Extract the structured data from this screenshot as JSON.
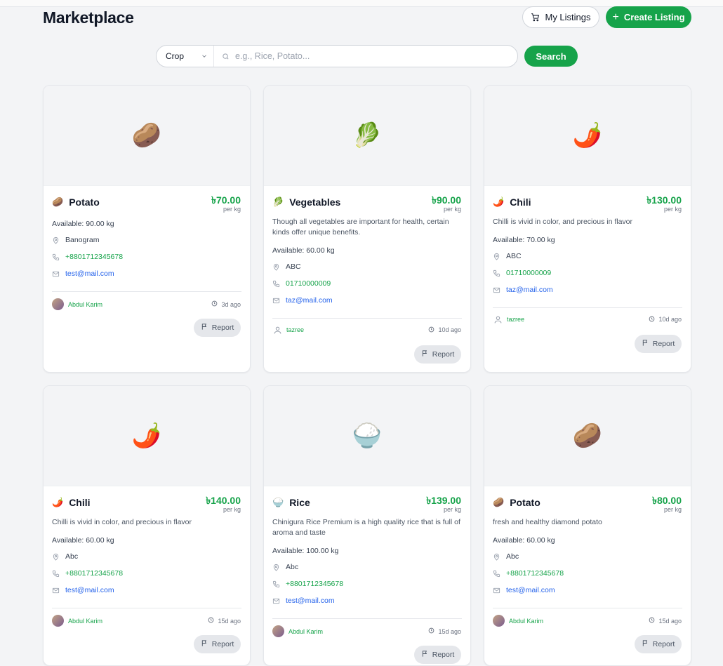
{
  "page": {
    "title": "Marketplace",
    "my_listings_label": "My Listings",
    "create_listing_label": "Create Listing",
    "search_label": "Search",
    "crop_select_value": "Crop",
    "search_placeholder": "e.g., Rice, Potato...",
    "report_label": "Report",
    "price_unit": "per kg"
  },
  "listings": [
    {
      "emoji": "🥔",
      "name": "Potato",
      "price": "৳70.00",
      "description": "",
      "available": "Available: 90.00 kg",
      "location": "Banogram",
      "phone": "+8801712345678",
      "email": "test@mail.com",
      "seller": "Abdul Karim",
      "seller_has_avatar": true,
      "posted": "3d ago"
    },
    {
      "emoji": "🥬",
      "name": "Vegetables",
      "price": "৳90.00",
      "description": "Though all vegetables are important for health, certain kinds offer unique benefits.",
      "available": "Available: 60.00 kg",
      "location": "ABC",
      "phone": "01710000009",
      "email": "taz@mail.com",
      "seller": "tazree",
      "seller_has_avatar": false,
      "posted": "10d ago"
    },
    {
      "emoji": "🌶️",
      "name": "Chili",
      "price": "৳130.00",
      "description": "Chilli is vivid in color, and precious in flavor",
      "available": "Available: 70.00 kg",
      "location": "ABC",
      "phone": "01710000009",
      "email": "taz@mail.com",
      "seller": "tazree",
      "seller_has_avatar": false,
      "posted": "10d ago"
    },
    {
      "emoji": "🌶️",
      "name": "Chili",
      "price": "৳140.00",
      "description": "Chilli is vivid in color, and precious in flavor",
      "available": "Available: 60.00 kg",
      "location": "Abc",
      "phone": "+8801712345678",
      "email": "test@mail.com",
      "seller": "Abdul Karim",
      "seller_has_avatar": true,
      "posted": "15d ago"
    },
    {
      "emoji": "🍚",
      "name": "Rice",
      "price": "৳139.00",
      "description": "Chinigura Rice Premium is a high quality rice that is full of aroma and taste",
      "available": "Available: 100.00 kg",
      "location": "Abc",
      "phone": "+8801712345678",
      "email": "test@mail.com",
      "seller": "Abdul Karim",
      "seller_has_avatar": true,
      "posted": "15d ago"
    },
    {
      "emoji": "🥔",
      "name": "Potato",
      "price": "৳80.00",
      "description": "fresh and healthy diamond potato",
      "available": "Available: 60.00 kg",
      "location": "Abc",
      "phone": "+8801712345678",
      "email": "test@mail.com",
      "seller": "Abdul Karim",
      "seller_has_avatar": true,
      "posted": "15d ago"
    }
  ],
  "colors": {
    "accent": "#16a34a",
    "link": "#2563eb",
    "background": "#f3f4f6"
  },
  "icons": [
    "cart-icon",
    "plus-icon",
    "chevron-down-icon",
    "search-icon",
    "location-pin-icon",
    "phone-icon",
    "mail-icon",
    "user-icon",
    "clock-icon",
    "flag-icon"
  ]
}
